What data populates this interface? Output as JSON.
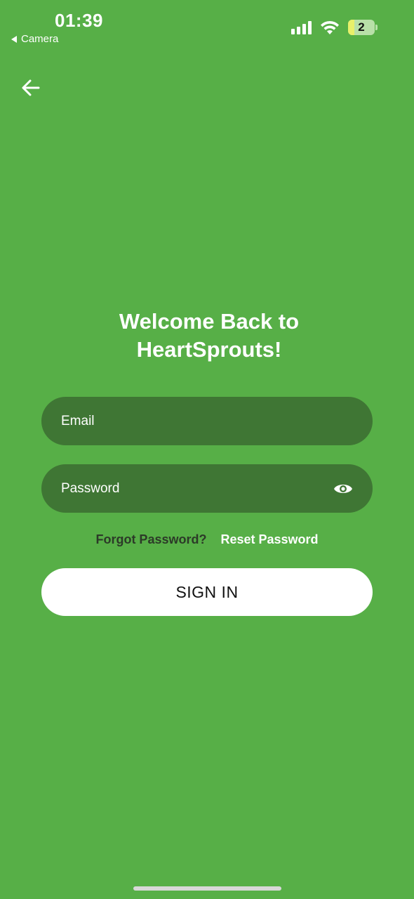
{
  "status_bar": {
    "time": "01:39",
    "back_label": "Camera",
    "battery_level": "2"
  },
  "login": {
    "title_line1": "Welcome Back to",
    "title_line2": "HeartSprouts!",
    "email_placeholder": "Email",
    "password_placeholder": "Password",
    "forgot_text": "Forgot Password?",
    "reset_link": "Reset Password",
    "signin_label": "SIGN IN"
  },
  "icons": {
    "back": "arrow-left-icon",
    "visibility": "eye-icon"
  },
  "colors": {
    "background": "#57AF47",
    "input_background": "#3F7634",
    "button_background": "#FFFFFF"
  }
}
